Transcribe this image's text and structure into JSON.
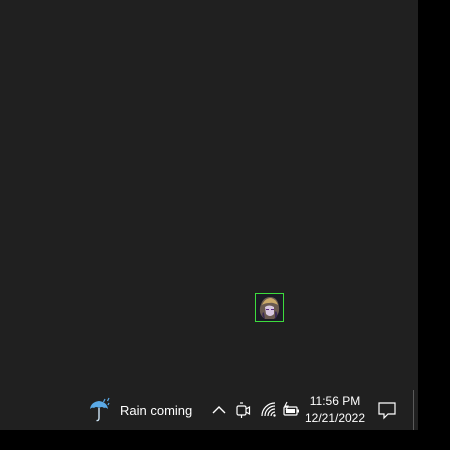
{
  "desktop": {
    "background": "#202020",
    "icons": [
      {
        "name": "game-avatar",
        "selected": true
      }
    ]
  },
  "taskbar": {
    "background": "#202020",
    "weather": {
      "icon": "umbrella-rain-icon",
      "text": "Rain coming"
    },
    "tray": {
      "chevron_icon": "chevron-up-icon",
      "meet_now_icon": "camera-icon",
      "network_icon": "wifi-icon",
      "battery_icon": "battery-charging-icon"
    },
    "clock": {
      "time": "11:56 PM",
      "date": "12/21/2022"
    },
    "notifications_icon": "notification-icon"
  },
  "colors": {
    "accent_selection": "#3ddc3d",
    "weather_icon": "#5aa9e6",
    "text": "#ffffff"
  }
}
